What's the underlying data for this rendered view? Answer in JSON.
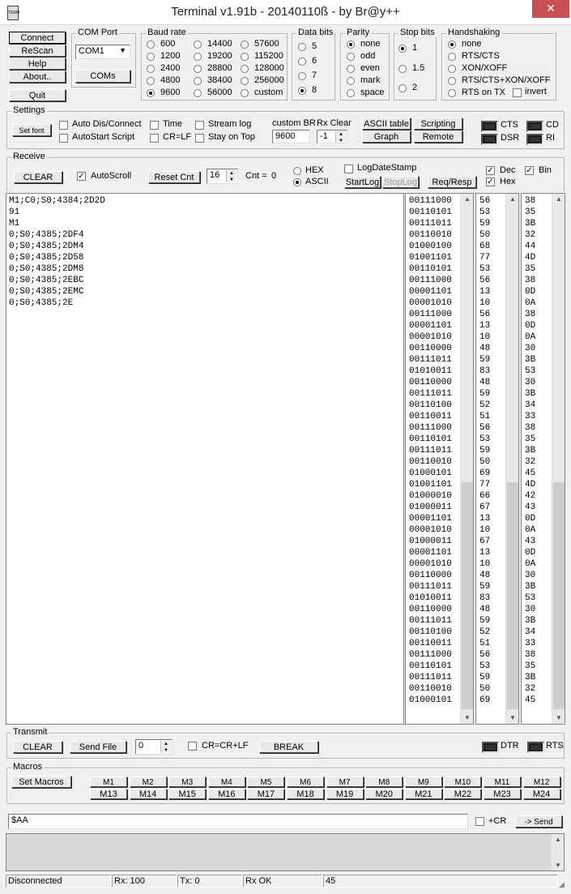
{
  "window": {
    "title": "Terminal v1.91b - 20140110ß - by Br@y++",
    "icon_text": "TERM",
    "close_glyph": "✕"
  },
  "left_buttons": {
    "connect": "Connect",
    "rescan": "ReScan",
    "help": "Help",
    "about": "About..",
    "quit": "Quit"
  },
  "com_port": {
    "label": "COM Port",
    "selected": "COM1",
    "coms_button": "COMs"
  },
  "baud_rate": {
    "label": "Baud rate",
    "options": [
      "600",
      "1200",
      "2400",
      "4800",
      "9600",
      "14400",
      "19200",
      "28800",
      "38400",
      "56000",
      "57600",
      "115200",
      "128000",
      "256000",
      "custom"
    ],
    "selected": "9600"
  },
  "data_bits": {
    "label": "Data bits",
    "options": [
      "5",
      "6",
      "7",
      "8"
    ],
    "selected": "8"
  },
  "parity": {
    "label": "Parity",
    "options": [
      "none",
      "odd",
      "even",
      "mark",
      "space"
    ],
    "selected": "none"
  },
  "stop_bits": {
    "label": "Stop bits",
    "options": [
      "1",
      "1.5",
      "2"
    ],
    "selected": "1"
  },
  "handshaking": {
    "label": "Handshaking",
    "options": [
      "none",
      "RTS/CTS",
      "XON/XOFF",
      "RTS/CTS+XON/XOFF",
      "RTS on TX"
    ],
    "selected": "none",
    "invert_label": "invert"
  },
  "settings": {
    "label": "Settings",
    "set_font": "Set font",
    "auto_dis_connect": "Auto Dis/Connect",
    "autostart_script": "AutoStart Script",
    "time": "Time",
    "cr_lf": "CR=LF",
    "stream_log": "Stream log",
    "stay_on_top": "Stay on Top",
    "custom_br_label": "custom BR",
    "custom_br_value": "9600",
    "rx_clear_label": "Rx Clear",
    "rx_clear_value": "-1",
    "ascii_table": "ASCII table",
    "graph": "Graph",
    "scripting": "Scripting",
    "remote": "Remote",
    "cts": "CTS",
    "dsr": "DSR",
    "cd": "CD",
    "ri": "RI"
  },
  "receive": {
    "label": "Receive",
    "clear": "CLEAR",
    "autoscroll": "AutoScroll",
    "reset_cnt": "Reset Cnt",
    "cnt_spin": "16",
    "cnt_label": "Cnt =",
    "cnt_value": "0",
    "hex": "HEX",
    "ascii": "ASCII",
    "format_selected": "ASCII",
    "logdatestamp": "LogDateStamp",
    "startlog": "StartLog",
    "stoplog": "StopLog",
    "req_resp": "Req/Resp",
    "dec": "Dec",
    "hex_chk": "Hex",
    "bin": "Bin",
    "ascii_lines": [
      "M1;C0;S0;4384;2D2D",
      "91",
      "M1",
      "0;S0;4385;2DF4",
      "0;S0;4385;2DM4",
      "0;S0;4385;2D58",
      "0;S0;4385;2DM8",
      "0;S0;4385;2EBC",
      "0;S0;4385;2EMC",
      "0;S0;4385;2E"
    ],
    "bin_lines": [
      "00111000",
      "00110101",
      "00111011",
      "00110010",
      "01000100",
      "01001101",
      "00110101",
      "00111000",
      "00001101",
      "00001010",
      "00111000",
      "00001101",
      "00001010",
      "00110000",
      "00111011",
      "01010011",
      "00110000",
      "00111011",
      "00110100",
      "00110011",
      "00111000",
      "00110101",
      "00111011",
      "00110010",
      "01000101",
      "01001101",
      "01000010",
      "01000011",
      "00001101",
      "00001010",
      "01000011",
      "00001101",
      "00001010",
      "00110000",
      "00111011",
      "01010011",
      "00110000",
      "00111011",
      "00110100",
      "00110011",
      "00111000",
      "00110101",
      "00111011",
      "00110010",
      "01000101"
    ],
    "dec_lines": [
      "56",
      "53",
      "59",
      "50",
      "68",
      "77",
      "53",
      "56",
      "13",
      "10",
      "56",
      "13",
      "10",
      "48",
      "59",
      "83",
      "48",
      "59",
      "52",
      "51",
      "56",
      "53",
      "59",
      "50",
      "69",
      "77",
      "66",
      "67",
      "13",
      "10",
      "67",
      "13",
      "10",
      "48",
      "59",
      "83",
      "48",
      "59",
      "52",
      "51",
      "56",
      "53",
      "59",
      "50",
      "69"
    ],
    "hex_lines": [
      "38",
      "35",
      "3B",
      "32",
      "44",
      "4D",
      "35",
      "38",
      "0D",
      "0A",
      "38",
      "0D",
      "0A",
      "30",
      "3B",
      "53",
      "30",
      "3B",
      "34",
      "33",
      "38",
      "35",
      "3B",
      "32",
      "45",
      "4D",
      "42",
      "43",
      "0D",
      "0A",
      "43",
      "0D",
      "0A",
      "30",
      "3B",
      "53",
      "30",
      "3B",
      "34",
      "33",
      "38",
      "35",
      "3B",
      "32",
      "45"
    ]
  },
  "transmit": {
    "label": "Transmit",
    "clear": "CLEAR",
    "send_file": "Send File",
    "spin_value": "0",
    "cr_crlf": "CR=CR+LF",
    "break": "BREAK",
    "dtr": "DTR",
    "rts": "RTS"
  },
  "macros": {
    "label": "Macros",
    "set_macros": "Set Macros",
    "row1": [
      "M1",
      "M2",
      "M3",
      "M4",
      "M5",
      "M6",
      "M7",
      "M8",
      "M9",
      "M10",
      "M11",
      "M12"
    ],
    "row2": [
      "M13",
      "M14",
      "M15",
      "M16",
      "M17",
      "M18",
      "M19",
      "M20",
      "M21",
      "M22",
      "M23",
      "M24"
    ]
  },
  "send_line": {
    "value": "$AA",
    "plus_cr": "+CR",
    "send_button": "-> Send"
  },
  "status": {
    "connection": "Disconnected",
    "rx": "Rx: 100",
    "tx": "Tx: 0",
    "rx_ok": "Rx OK",
    "last": "45"
  }
}
